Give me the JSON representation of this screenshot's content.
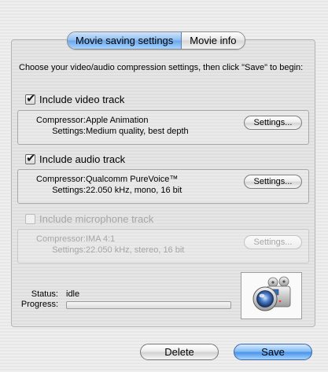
{
  "tabs": [
    {
      "label": "Movie saving settings",
      "active": true
    },
    {
      "label": "Movie info",
      "active": false
    }
  ],
  "intro": "Choose your video/audio compression settings, then click \"Save\" to begin:",
  "video": {
    "checkbox_label": "Include video track",
    "checked": true,
    "compressor_label": "Compressor:",
    "compressor_value": "Apple Animation",
    "settings_label": "Settings:",
    "settings_value": "Medium quality, best depth",
    "button": "Settings..."
  },
  "audio": {
    "checkbox_label": "Include audio track",
    "checked": true,
    "compressor_label": "Compressor:",
    "compressor_value": "Qualcomm PureVoice™",
    "settings_label": "Settings:",
    "settings_value": "22.050 kHz, mono, 16 bit",
    "button": "Settings..."
  },
  "microphone": {
    "checkbox_label": "Include microphone track",
    "checked": false,
    "enabled": false,
    "compressor_label": "Compressor:",
    "compressor_value": "IMA 4:1",
    "settings_label": "Settings:",
    "settings_value": "22.050 kHz, stereo, 16 bit",
    "button": "Settings..."
  },
  "status": {
    "status_label": "Status:",
    "status_value": "idle",
    "progress_label": "Progress:",
    "progress_fraction": 0
  },
  "preview": {
    "icon": "movie-camera-icon"
  },
  "footer": {
    "delete_label": "Delete",
    "save_label": "Save"
  },
  "colors": {
    "accent": "#6aa6ea",
    "background": "#ededed"
  }
}
